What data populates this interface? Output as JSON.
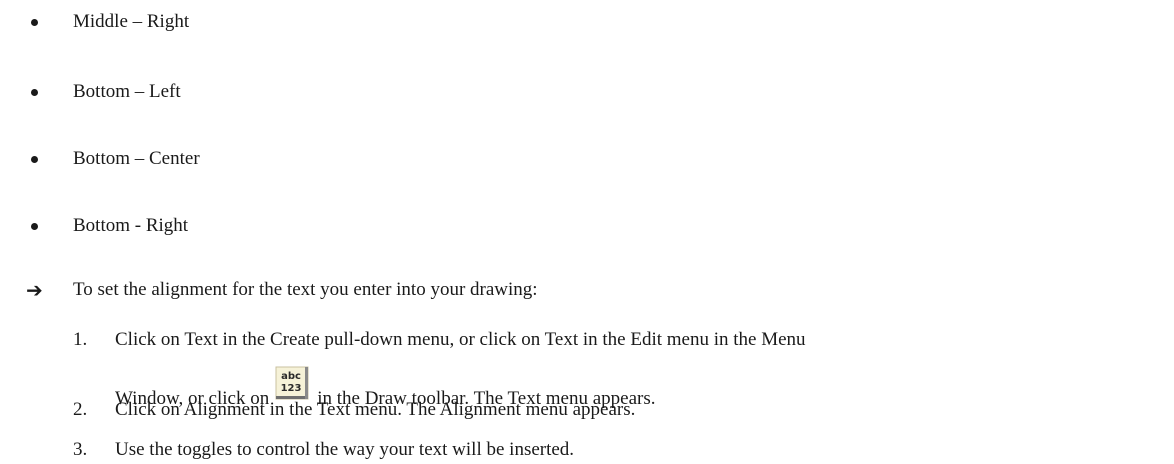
{
  "bullets": [
    "Middle – Right",
    "Bottom – Left",
    "Bottom – Center",
    "Bottom - Right"
  ],
  "arrow_item": {
    "text": "To set the alignment for the text you enter into your drawing:"
  },
  "steps": [
    {
      "number": "1.",
      "line1": "Click on Text in the Create pull-down menu, or click on Text in the Edit menu in the Menu",
      "line2_before": "Window, or click on",
      "icon": "abc-123-text-tool-icon",
      "icon_top_text": "abc",
      "icon_bottom_text": "123",
      "line2_after": "in the Draw toolbar. The Text menu appears."
    },
    {
      "number": "2.",
      "text": "Click on Alignment in the Text menu. The Alignment menu appears."
    },
    {
      "number": "3.",
      "text": "Use the toggles to control the way your text will be inserted."
    }
  ]
}
